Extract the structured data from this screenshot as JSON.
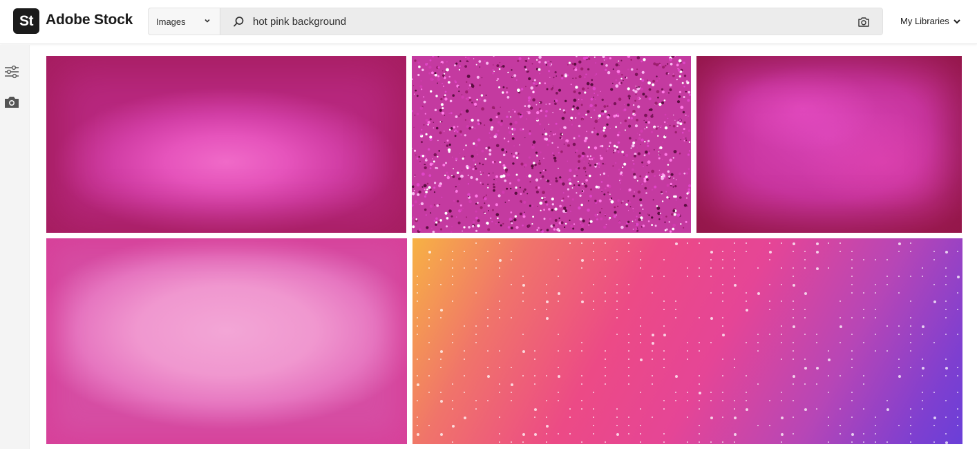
{
  "header": {
    "logo_mark": "St",
    "logo_text": "Adobe Stock",
    "libraries_label": "My Libraries"
  },
  "search": {
    "type_selected": "Images",
    "query": "hot pink background"
  },
  "icons": {
    "search": "search-icon",
    "camera_search": "camera-icon",
    "rail_filters": "filters-icon",
    "rail_camera": "camera-icon"
  },
  "results": [
    {
      "description": "magenta vignette gradient"
    },
    {
      "description": "pink glitter texture"
    },
    {
      "description": "grunge magenta texture"
    },
    {
      "description": "light pink grunge frame"
    },
    {
      "description": "pink to purple gradient with stars"
    }
  ],
  "colors": {
    "brand_dark": "#1b1b1b",
    "search_bg": "#ececec"
  }
}
